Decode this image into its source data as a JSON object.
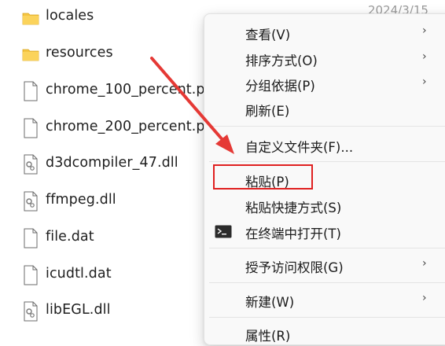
{
  "files": [
    {
      "name": "locales",
      "kind": "folder-icon"
    },
    {
      "name": "resources",
      "kind": "folder-icon"
    },
    {
      "name": "chrome_100_percent.pa",
      "kind": "file-icon"
    },
    {
      "name": "chrome_200_percent.pa",
      "kind": "file-icon"
    },
    {
      "name": "d3dcompiler_47.dll",
      "kind": "dll-icon"
    },
    {
      "name": "ffmpeg.dll",
      "kind": "dll-icon"
    },
    {
      "name": "file.dat",
      "kind": "file-icon"
    },
    {
      "name": "icudtl.dat",
      "kind": "file-icon"
    },
    {
      "name": "libEGL.dll",
      "kind": "dll-icon"
    }
  ],
  "date_partial": "2024/3/15",
  "menu": {
    "items": [
      {
        "label": "查看(V)",
        "submenu": true
      },
      {
        "label": "排序方式(O)",
        "submenu": true
      },
      {
        "label": "分组依据(P)",
        "submenu": true
      },
      {
        "label": "刷新(E)",
        "submenu": false
      },
      {
        "label": "自定义文件夹(F)...",
        "submenu": false
      },
      {
        "label": "粘贴(P)",
        "submenu": false
      },
      {
        "label": "粘贴快捷方式(S)",
        "submenu": false
      },
      {
        "label": "在终端中打开(T)",
        "submenu": false,
        "icon": "terminal-icon"
      },
      {
        "label": "授予访问权限(G)",
        "submenu": true
      },
      {
        "label": "新建(W)",
        "submenu": true
      },
      {
        "label": "属性(R)",
        "submenu": false
      }
    ],
    "submenu_glyph": "›"
  },
  "colors": {
    "folder": "#f2c94c",
    "highlight_border": "#e02020",
    "arrow": "#e53935"
  }
}
